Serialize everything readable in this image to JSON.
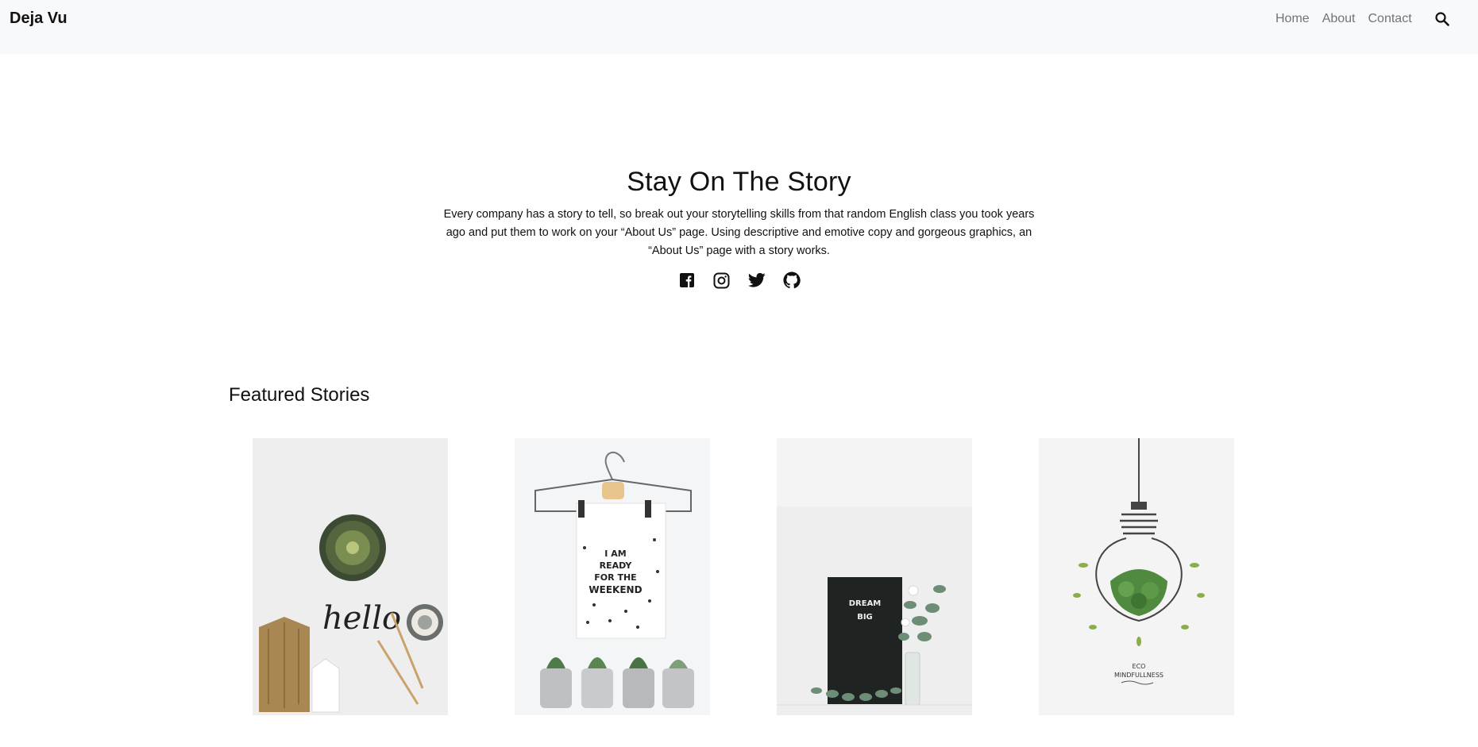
{
  "nav": {
    "brand": "Deja Vu",
    "links": [
      "Home",
      "About",
      "Contact"
    ],
    "search_icon": "search-icon"
  },
  "hero": {
    "title": "Stay On The Story",
    "text": "Every company has a story to tell, so break out your storytelling skills from that random English class you took years ago and put them to work on your “About Us” page. Using descriptive and emotive copy and gorgeous graphics, an “About Us” page with a story works.",
    "socials": [
      "facebook-icon",
      "instagram-icon",
      "twitter-icon",
      "github-icon"
    ]
  },
  "featured": {
    "title": "Featured Stories",
    "cards": [
      {
        "image": "cactus-hello-photo",
        "text": "hello"
      },
      {
        "image": "hanger-poster-photo",
        "text": "I AM READY FOR THE WEEKEND"
      },
      {
        "image": "letterboard-photo",
        "text": "DREAM BIG"
      },
      {
        "image": "lightbulb-plant-photo",
        "text": "ECO MINDFULLNESS"
      }
    ]
  }
}
